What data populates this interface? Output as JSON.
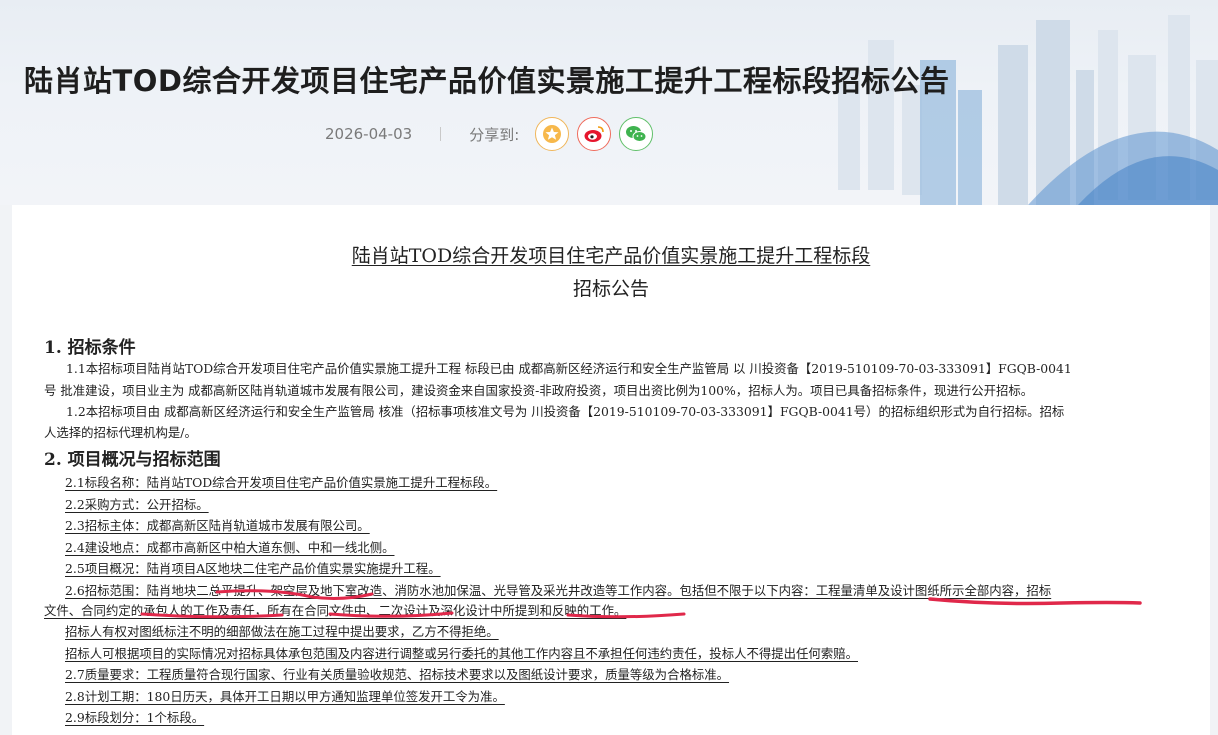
{
  "header": {
    "title": "陆肖站TOD综合开发项目住宅产品价值实景施工提升工程标段招标公告",
    "date": "2026-04-03",
    "share_label": "分享到:",
    "share_icons": [
      "favorite-icon",
      "weibo-icon",
      "wechat-icon"
    ]
  },
  "document": {
    "title_line1": "陆肖站TOD综合开发项目住宅产品价值实景施工提升工程标段",
    "title_line2": "招标公告",
    "section1": {
      "heading": "1. 招标条件",
      "lines": [
        "1.1本招标项目陆肖站TOD综合开发项目住宅产品价值实景施工提升工程  标段已由  成都高新区经济运行和安全生产监管局  以  川投资备【2019-510109-70-03-333091】FGQB-0041",
        "号  批准建设，项目业主为  成都高新区陆肖轨道城市发展有限公司，建设资金来自国家投资-非政府投资，项目出资比例为100%，招标人为。项目已具备招标条件，现进行公开招标。",
        "1.2本招标项目由  成都高新区经济运行和安全生产监管局  核准（招标事项核准文号为  川投资备【2019-510109-70-03-333091】FGQB-0041号）的招标组织形式为自行招标。招标",
        "人选择的招标代理机构是/。"
      ]
    },
    "section2": {
      "heading": "2. 项目概况与招标范围",
      "items": [
        "2.1标段名称：陆肖站TOD综合开发项目住宅产品价值实景施工提升工程标段。",
        "2.2采购方式：公开招标。",
        "2.3招标主体：成都高新区陆肖轨道城市发展有限公司。",
        "2.4建设地点：成都市高新区中柏大道东侧、中和一线北侧。",
        "2.5项目概况：陆肖项目A区地块二住宅产品价值实景实施提升工程。",
        "2.6招标范围：陆肖地块二总平提升、架空层及地下室改造、消防水池加保温、光导管及采光井改造等工作内容。包括但不限于以下内容：工程量清单及设计图纸所示全部内容，招标",
        "文件、合同约定的承包人的工作及责任，所有在合同文件中、二次设计及深化设计中所提到和反映的工作。",
        "招标人有权对图纸标注不明的细部做法在施工过程中提出要求，乙方不得拒绝。",
        "招标人可根据项目的实际情况对招标具体承包范围及内容进行调整或另行委托的其他工作内容且不承担任何违约责任，投标人不得提出任何索赔。",
        "2.7质量要求：工程质量符合现行国家、行业有关质量验收规范、招标技术要求以及图纸设计要求，质量等级为合格标准。",
        "2.8计划工期：180日历天，具体开工日期以甲方通知监理单位签发开工令为准。",
        "2.9标段划分：1个标段。"
      ]
    }
  },
  "colors": {
    "highlight_stroke": "#e0284a",
    "title_text": "#1e1e1e",
    "meta_text": "#7a7a7a"
  }
}
